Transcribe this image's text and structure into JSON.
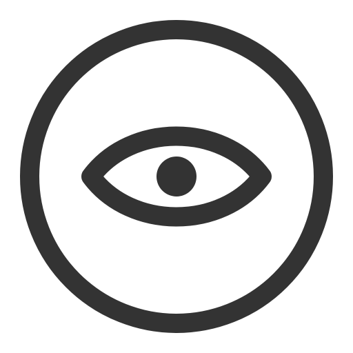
{
  "icon": {
    "name": "eye-in-circle-icon",
    "stroke_color": "#333333",
    "background_color": "#ffffff"
  }
}
